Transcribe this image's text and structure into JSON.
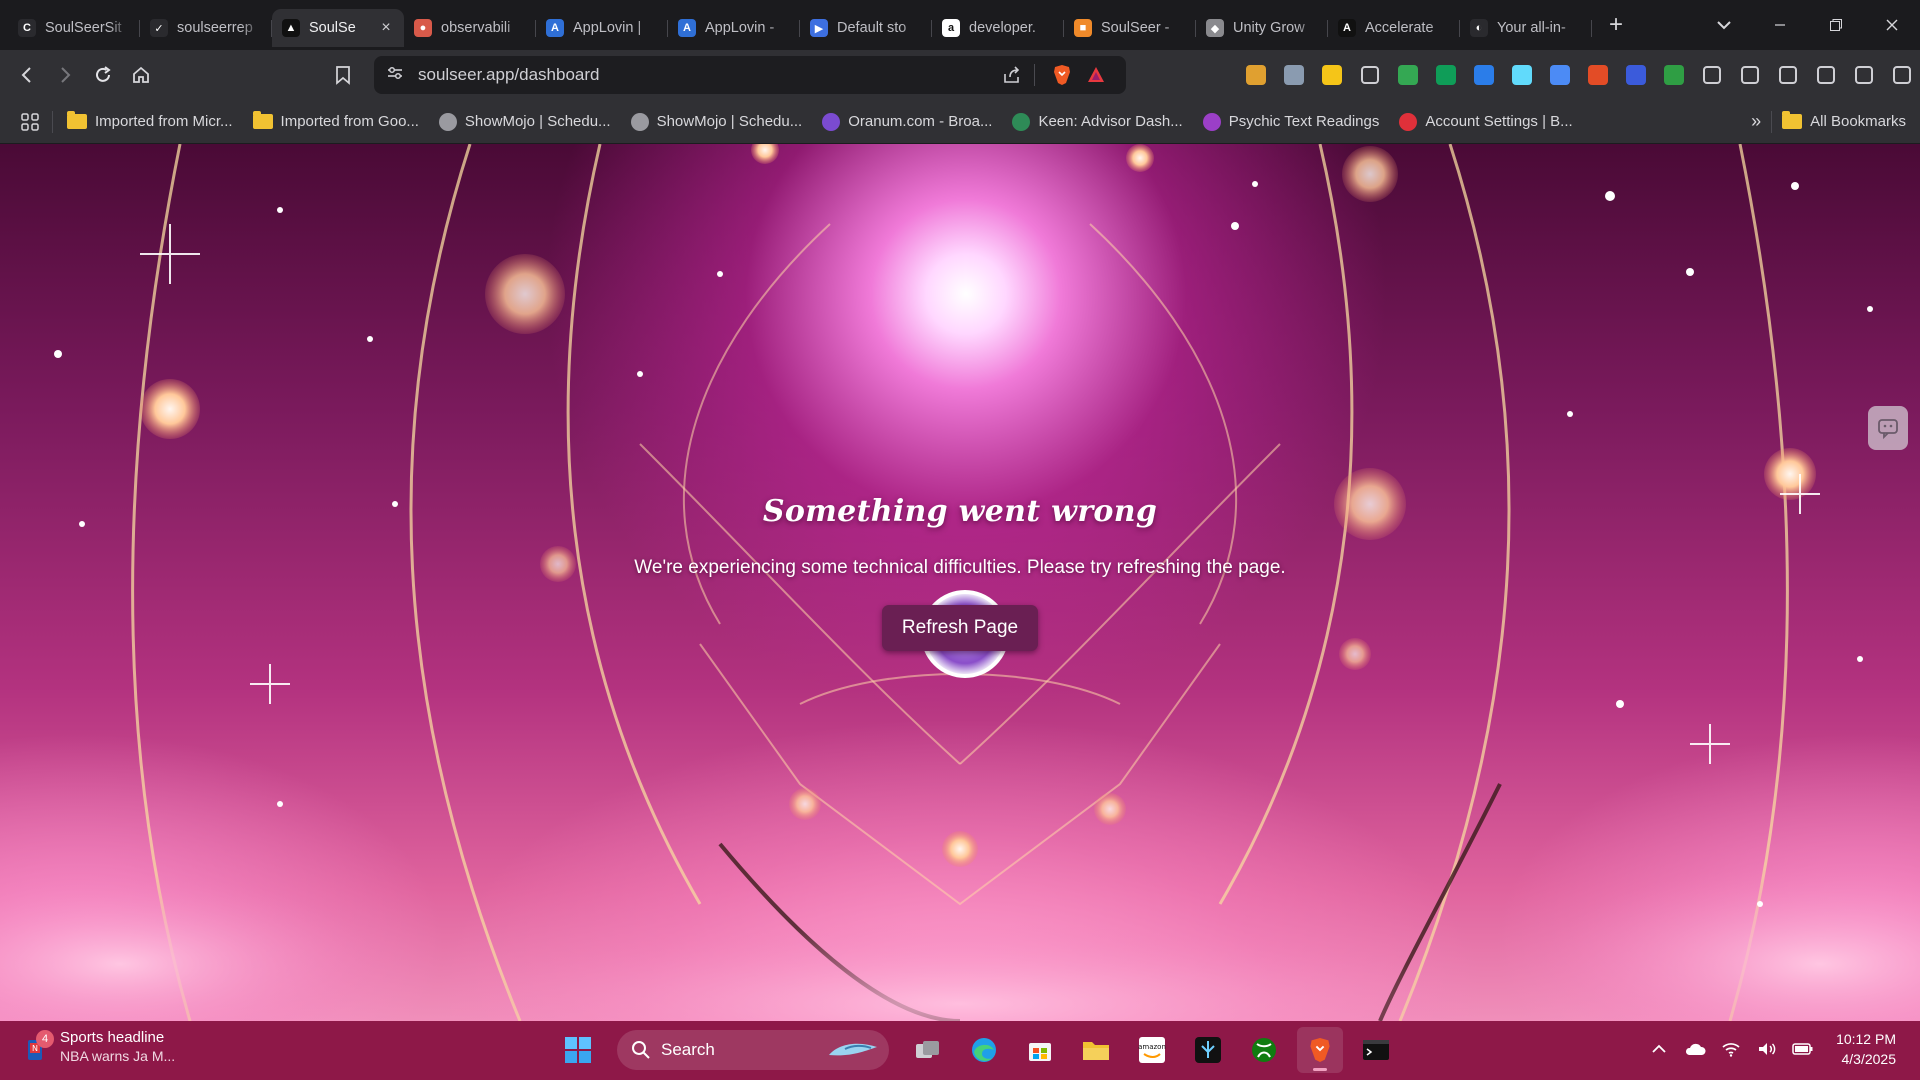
{
  "browser": {
    "tabs": [
      {
        "title": "SoulSeerSit",
        "favicon_color": "#2a2a2e",
        "favicon": "C",
        "active": false
      },
      {
        "title": "soulseerrep",
        "favicon_color": "#2a2a2e",
        "favicon": "✓",
        "active": false
      },
      {
        "title": "SoulSe",
        "favicon_color": "#111111",
        "favicon": "▲",
        "active": true
      },
      {
        "title": "observabili",
        "favicon_color": "#d85a4a",
        "favicon": "●",
        "active": false
      },
      {
        "title": "AppLovin |",
        "favicon_color": "#2f6fd6",
        "favicon": "A",
        "active": false
      },
      {
        "title": "AppLovin -",
        "favicon_color": "#2f6fd6",
        "favicon": "A",
        "active": false
      },
      {
        "title": "Default sto",
        "favicon_color": "#3d6fe0",
        "favicon": "▶",
        "active": false
      },
      {
        "title": "developer.",
        "favicon_color": "#ffffff",
        "favicon": "a",
        "active": false
      },
      {
        "title": "SoulSeer -",
        "favicon_color": "#f08a2a",
        "favicon": "■",
        "active": false
      },
      {
        "title": "Unity Grow",
        "favicon_color": "#8a8a8e",
        "favicon": "◆",
        "active": false
      },
      {
        "title": "Accelerate",
        "favicon_color": "#111111",
        "favicon": "A",
        "active": false
      },
      {
        "title": "Your all-in-",
        "favicon_color": "#2a2a2e",
        "favicon": "◐",
        "active": false
      }
    ],
    "new_tab_label": "+",
    "tab_search_icon": "chevron-down-icon",
    "url": "soulseer.app/dashboard",
    "extension_icons": [
      "color-wheel-icon",
      "image-icon",
      "bookmark-yellow-icon",
      "bookmark-icon",
      "drive-icon",
      "sheets-icon",
      "circle-blue-icon",
      "react-icon",
      "phone-icon",
      "html-icon",
      "puzzle-blue-icon",
      "grammar-icon",
      "extensions-icon",
      "sidebar-icon",
      "wallet-icon",
      "leo-icon",
      "vpn-icon",
      "menu-icon"
    ],
    "extension_colors": [
      "#e0a030",
      "#8a9bb0",
      "#f5c518",
      "#cfcfd4",
      "#34a853",
      "#0f9d58",
      "#2b7de9",
      "#61dafb",
      "#4c8bf5",
      "#e34c26",
      "#3b5bdb",
      "#2f9e44",
      "#cfcfd4",
      "#cfcfd4",
      "#cfcfd4",
      "#cfcfd4",
      "#cfcfd4",
      "#cfcfd4"
    ]
  },
  "bookmarks": {
    "items": [
      {
        "label": "Imported from Micr...",
        "type": "folder"
      },
      {
        "label": "Imported from Goo...",
        "type": "folder"
      },
      {
        "label": "ShowMojo | Schedu...",
        "type": "site",
        "color": "#9a9aa0"
      },
      {
        "label": "ShowMojo | Schedu...",
        "type": "site",
        "color": "#9a9aa0"
      },
      {
        "label": "Oranum.com - Broa...",
        "type": "site",
        "color": "#7b4bd1"
      },
      {
        "label": "Keen: Advisor Dash...",
        "type": "site",
        "color": "#2e8b57"
      },
      {
        "label": "Psychic Text Readings",
        "type": "site",
        "color": "#9b3fc7"
      },
      {
        "label": "Account Settings | B...",
        "type": "site",
        "color": "#e0303a"
      }
    ],
    "overflow_label": "»",
    "all_bookmarks_label": "All Bookmarks"
  },
  "page": {
    "error_title": "Something went wrong",
    "error_message": "We're experiencing some technical difficulties. Please try refreshing the page.",
    "refresh_button_label": "Refresh Page"
  },
  "taskbar": {
    "news_badge": "4",
    "news_line1": "Sports headline",
    "news_line2": "NBA warns Ja M...",
    "search_placeholder": "Search",
    "pinned_apps": [
      "task-view-icon",
      "edge-icon",
      "store-icon",
      "file-explorer-icon",
      "amazon-icon",
      "unknown-app-icon",
      "xbox-icon",
      "brave-icon",
      "terminal-icon"
    ],
    "time": "10:12 PM",
    "date": "4/3/2025"
  }
}
